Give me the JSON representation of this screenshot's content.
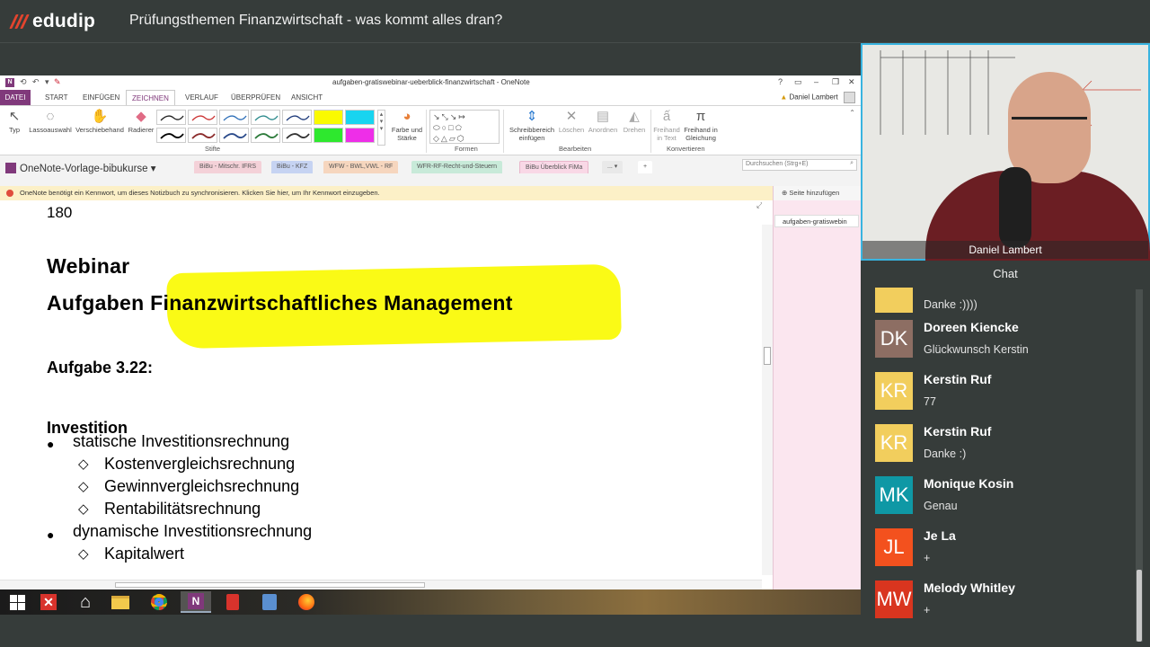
{
  "header": {
    "logo_text": "edudip",
    "title": "Prüfungsthemen Finanzwirtschaft - was kommt alles dran?"
  },
  "onenote": {
    "window_title": "aufgaben-gratiswebinar-ueberblick-finanzwirtschaft - OneNote",
    "app_icon_letter": "N",
    "user_name": "Daniel Lambert",
    "ribbon_tabs": [
      "DATEI",
      "START",
      "EINFÜGEN",
      "ZEICHNEN",
      "VERLAUF",
      "ÜBERPRÜFEN",
      "ANSICHT"
    ],
    "active_tab": "ZEICHNEN",
    "ribbon": {
      "typ": "Typ",
      "lasso": "Lassoauswahl",
      "pan": "Verschiebehand",
      "eraser": "Radierer",
      "color_width_1": "Farbe und",
      "color_width_2": "Stärke",
      "group_pens": "Stifte",
      "group_shapes": "Formen",
      "writing_space_1": "Schreibbereich",
      "writing_space_2": "einfügen",
      "delete": "Löschen",
      "arrange": "Anordnen",
      "rotate": "Drehen",
      "group_edit": "Bearbeiten",
      "ink_text_1": "Freihand",
      "ink_text_2": "in Text",
      "ink_math_1": "Freihand in",
      "ink_math_2": "Gleichung",
      "group_convert": "Konvertieren"
    },
    "notebook_name": "OneNote-Vorlage-bibukurse",
    "sections": [
      {
        "label": "BiBu - Mitschr. IFRS",
        "color": "#f4d1d8"
      },
      {
        "label": "BiBu - KFZ",
        "color": "#c6d3f2"
      },
      {
        "label": "WFW - BWL,VWL - RF",
        "color": "#f6d6be"
      },
      {
        "label": "WFR-RF-Recht-und-Steuern",
        "color": "#c8ead9"
      },
      {
        "label": "BiBu Überblick FiMa",
        "color": "#f9d8e6"
      }
    ],
    "more_sections": "...",
    "search_placeholder": "Durchsuchen (Strg+E)",
    "message_bar": "OneNote benötigt ein Kennwort, um dieses Notizbuch zu synchronisieren. Klicken Sie hier, um Ihr Kennwort einzugeben.",
    "add_page": "Seite hinzufügen",
    "page_tab": "aufgaben-gratiswebin",
    "page": {
      "number": "180",
      "heading1": "Webinar",
      "heading2_prefix": "Aufgaben",
      "heading2_highlight": "Finanzwirtschaftliches Management",
      "task": "Aufgabe 3.22:",
      "section": "Investition",
      "bullet1": "statische Investitionsrechnung",
      "sub1": "Kostenvergleichsrechnung",
      "sub2": "Gewinnvergleichsrechnung",
      "sub3": "Rentabilitätsrechnung",
      "bullet2": "dynamische Investitionsrechnung",
      "sub4": "Kapitalwert"
    }
  },
  "video": {
    "presenter_name": "Daniel Lambert"
  },
  "chat": {
    "title": "Chat",
    "partial_text": "Danke :))))",
    "messages": [
      {
        "initials": "DK",
        "name": "Doreen Kiencke",
        "text": "Glückwunsch Kerstin",
        "color": "#8d6e63"
      },
      {
        "initials": "KR",
        "name": "Kerstin Ruf",
        "text": "77",
        "color": "#f2ce5d"
      },
      {
        "initials": "KR",
        "name": "Kerstin Ruf",
        "text": "Danke :)",
        "color": "#f2ce5d"
      },
      {
        "initials": "MK",
        "name": "Monique Kosin",
        "text": "Genau",
        "color": "#0f98a5"
      },
      {
        "initials": "JL",
        "name": "Je La",
        "text": "+",
        "color": "#f3511e"
      },
      {
        "initials": "MW",
        "name": "Melody Whitley",
        "text": "+",
        "color": "#d9351f"
      }
    ]
  }
}
